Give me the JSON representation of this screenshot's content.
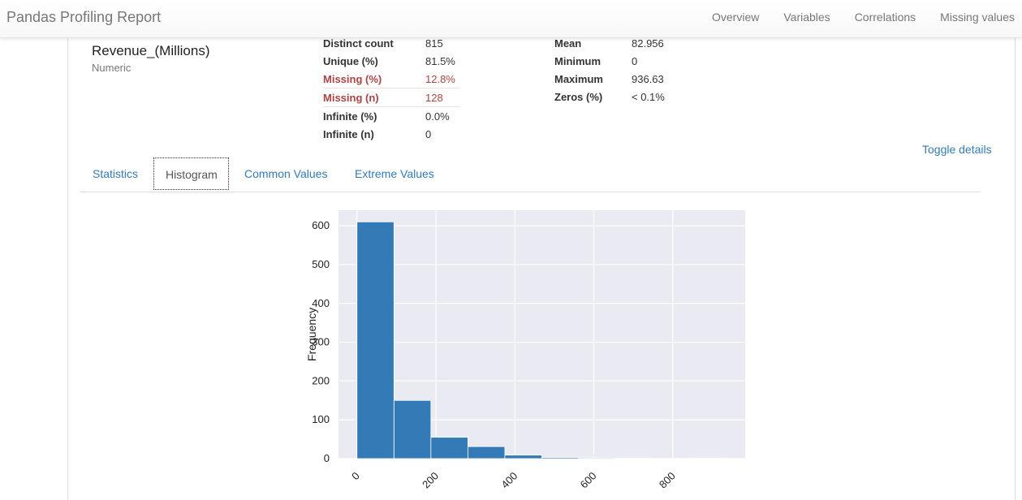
{
  "navbar": {
    "brand": "Pandas Profiling Report",
    "links": [
      "Overview",
      "Variables",
      "Correlations",
      "Missing values"
    ]
  },
  "variable": {
    "name": "Revenue_(Millions)",
    "type": "Numeric"
  },
  "stats_left": [
    {
      "label": "Distinct count",
      "value": "815"
    },
    {
      "label": "Unique (%)",
      "value": "81.5%"
    },
    {
      "label": "Missing (%)",
      "value": "12.8%"
    },
    {
      "label": "Missing (n)",
      "value": "128"
    },
    {
      "label": "Infinite (%)",
      "value": "0.0%"
    },
    {
      "label": "Infinite (n)",
      "value": "0"
    }
  ],
  "stats_right": [
    {
      "label": "Mean",
      "value": "82.956"
    },
    {
      "label": "Minimum",
      "value": "0"
    },
    {
      "label": "Maximum",
      "value": "936.63"
    },
    {
      "label": "Zeros (%)",
      "value": "< 0.1%"
    }
  ],
  "toggle_label": "Toggle details",
  "tabs": [
    "Statistics",
    "Histogram",
    "Common Values",
    "Extreme Values"
  ],
  "active_tab": "Histogram",
  "colors": {
    "bar": "#337ab7",
    "plot_bg": "#eaeaf2",
    "alert": "#a94442",
    "link": "#337ab7"
  },
  "chart_data": {
    "type": "bar",
    "title": "",
    "xlabel": "",
    "ylabel": "Frequency",
    "bin_edges": [
      0,
      93.663,
      187.326,
      280.989,
      374.652,
      468.315,
      561.978,
      655.641,
      749.304,
      842.967,
      936.63
    ],
    "values": [
      610,
      150,
      55,
      31,
      9,
      3,
      2,
      1,
      0,
      1
    ],
    "xticks": [
      0,
      200,
      400,
      600,
      800
    ],
    "yticks": [
      0,
      100,
      200,
      300,
      400,
      500,
      600
    ],
    "xlim": [
      -46.8,
      983.5
    ],
    "ylim": [
      0,
      640
    ],
    "grid": true
  }
}
